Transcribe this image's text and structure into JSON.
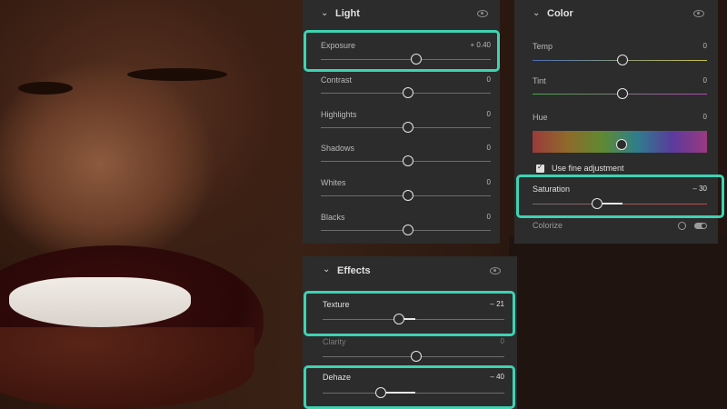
{
  "light": {
    "title": "Light",
    "sliders": [
      {
        "label": "Exposure",
        "value": "+ 0.40",
        "position": 0.55
      },
      {
        "label": "Contrast",
        "value": "0",
        "position": 0.5
      },
      {
        "label": "Highlights",
        "value": "0",
        "position": 0.5
      },
      {
        "label": "Shadows",
        "value": "0",
        "position": 0.5
      },
      {
        "label": "Whites",
        "value": "0",
        "position": 0.5
      },
      {
        "label": "Blacks",
        "value": "0",
        "position": 0.5
      }
    ]
  },
  "color": {
    "title": "Color",
    "sliders": [
      {
        "label": "Temp",
        "value": "0",
        "position": 0.5
      },
      {
        "label": "Tint",
        "value": "0",
        "position": 0.5
      }
    ],
    "hue": {
      "label": "Hue",
      "value": "0",
      "position": 0.5
    },
    "fine_adjustment": {
      "label": "Use fine adjustment",
      "checked": true
    },
    "saturation": {
      "label": "Saturation",
      "value": "– 30",
      "position": 0.35
    },
    "colorize": {
      "label": "Colorize",
      "enabled": false
    }
  },
  "effects": {
    "title": "Effects",
    "sliders": [
      {
        "label": "Texture",
        "value": "– 21",
        "position": 0.4
      },
      {
        "label": "Clarity",
        "value": "0",
        "position": 0.5
      },
      {
        "label": "Dehaze",
        "value": "– 40",
        "position": 0.3
      }
    ]
  },
  "colors": {
    "highlight": "#3ed3b3",
    "panel": "#2c2c2c"
  }
}
